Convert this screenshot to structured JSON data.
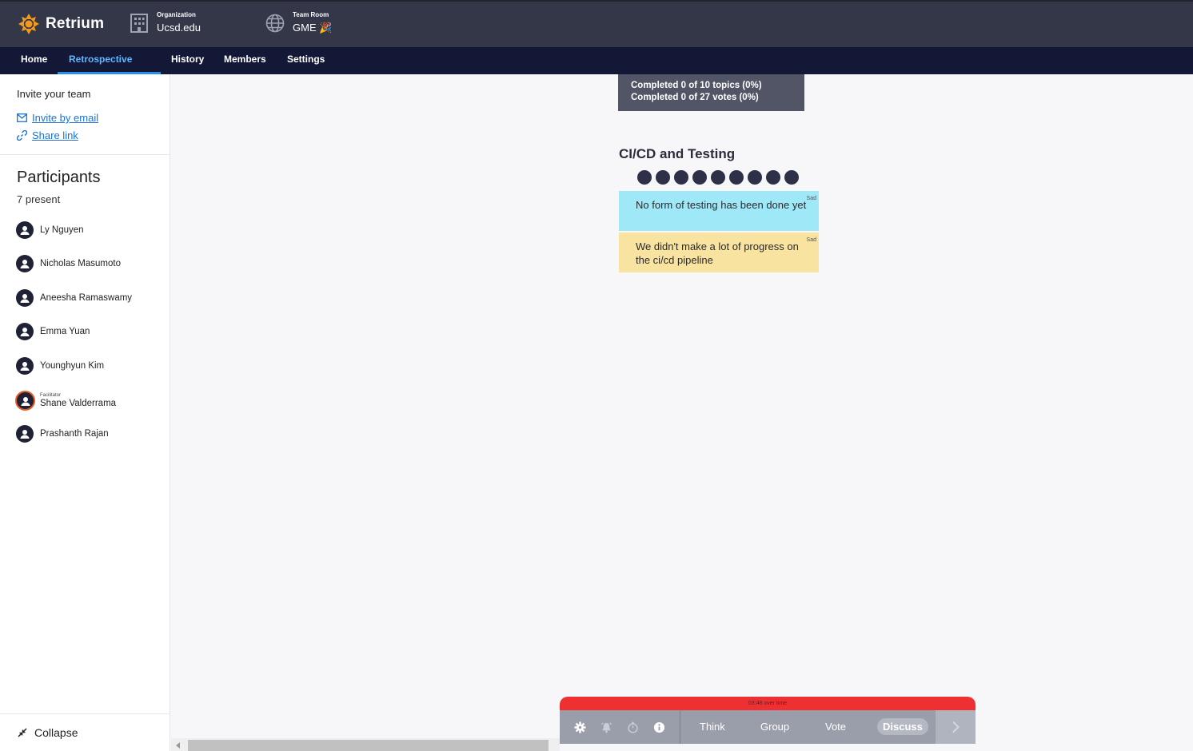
{
  "brand": {
    "name": "Retrium",
    "accent": "#f39a1e"
  },
  "header": {
    "organization": {
      "label": "Organization",
      "value": "Ucsd.edu"
    },
    "team_room": {
      "label": "Team Room",
      "value": "GME 🎉"
    }
  },
  "nav": {
    "items": [
      {
        "label": "Home",
        "active": false
      },
      {
        "label": "Retrospective",
        "active": true
      },
      {
        "label": "History",
        "active": false
      },
      {
        "label": "Members",
        "active": false
      },
      {
        "label": "Settings",
        "active": false
      }
    ],
    "kebab": "⋮"
  },
  "sidebar": {
    "invite_title": "Invite your team",
    "invite_email": "Invite by email",
    "share_link": "Share link",
    "participants_title": "Participants",
    "participants_count": "7 present",
    "participants": [
      {
        "name": "Ly Nguyen",
        "role": ""
      },
      {
        "name": "Nicholas Masumoto",
        "role": ""
      },
      {
        "name": "Aneesha Ramaswamy",
        "role": ""
      },
      {
        "name": "Emma Yuan",
        "role": ""
      },
      {
        "name": "Younghyun Kim",
        "role": ""
      },
      {
        "name": "Shane Valderrama",
        "role": "Facilitator"
      },
      {
        "name": "Prashanth Rajan",
        "role": ""
      }
    ],
    "collapse": "Collapse"
  },
  "main": {
    "progress_topics": "Completed 0 of 10 topics (0%)",
    "progress_votes": "Completed 0 of 27 votes (0%)",
    "topic_title": "CI/CD and Testing",
    "vote_count": 9,
    "cards": [
      {
        "text": "No form of testing has been done yet",
        "tag": "Sad",
        "color": "#9ee8f8"
      },
      {
        "text": "We didn't make a lot of progress on the ci/cd pipeline",
        "tag": "Sad",
        "color": "#f9e3a0"
      }
    ]
  },
  "controls": {
    "overtime": "03:48 over time",
    "icons": [
      "gear-icon",
      "alarm-icon",
      "stopwatch-icon",
      "info-icon"
    ],
    "phases": [
      "Think",
      "Group",
      "Vote",
      "Discuss"
    ],
    "active_phase": "Discuss",
    "overtime_color": "#ef3033"
  }
}
